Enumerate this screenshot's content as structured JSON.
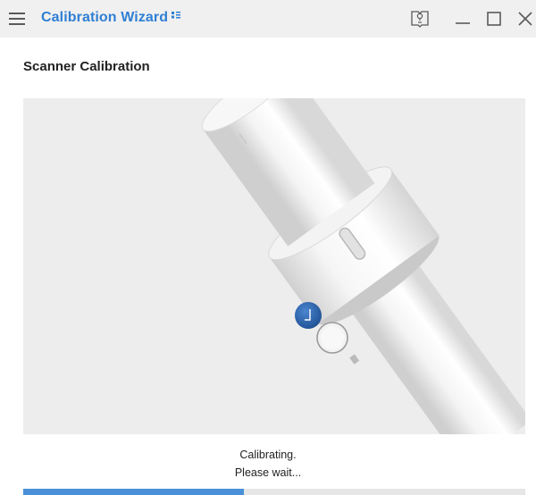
{
  "window": {
    "title": "Calibration Wizard"
  },
  "icons": {
    "menu": "hamburger-menu-icon",
    "help": "help-book-icon",
    "minimize": "minimize-icon",
    "maximize": "maximize-icon",
    "close": "close-icon"
  },
  "main": {
    "heading": "Scanner Calibration",
    "status_line1": "Calibrating.",
    "status_line2": "Please wait...",
    "progress": 0.44
  },
  "colors": {
    "accent": "#2f7fd4",
    "progress_fill": "#4a90d9",
    "titlebar_bg": "#f0f0f0",
    "device_panel_bg": "#ededed",
    "scanner_button": "#2b5fa6"
  }
}
